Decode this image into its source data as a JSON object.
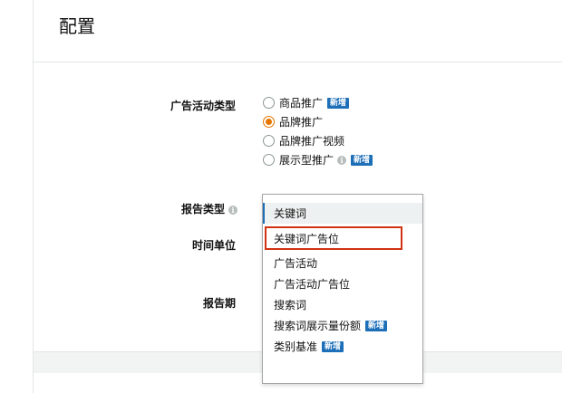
{
  "page": {
    "title": "配置"
  },
  "form": {
    "campaign_type_label": "广告活动类型",
    "campaign_types": [
      {
        "label": "商品推广",
        "badge": "新增",
        "checked": false
      },
      {
        "label": "品牌推广",
        "badge": "",
        "checked": true
      },
      {
        "label": "品牌推广视频",
        "badge": "",
        "checked": false
      },
      {
        "label": "展示型推广",
        "badge": "新增",
        "checked": false
      }
    ],
    "report_type_label": "报告类型",
    "time_unit_label": "时间单位",
    "report_period_label": "报告期"
  },
  "dropdown": {
    "options": [
      {
        "label": "关键词",
        "badge": ""
      },
      {
        "label": "关键词广告位",
        "badge": ""
      },
      {
        "label": "广告活动",
        "badge": ""
      },
      {
        "label": "广告活动广告位",
        "badge": ""
      },
      {
        "label": "搜索词",
        "badge": ""
      },
      {
        "label": "搜索词展示量份额",
        "badge": "新增"
      },
      {
        "label": "类别基准",
        "badge": "新增"
      }
    ],
    "selected_index": 0,
    "highlighted_index": 1
  },
  "colors": {
    "accent_radio": "#e77600",
    "badge_bg": "#1d6fb8",
    "highlight_border": "#d13212"
  },
  "icons": {
    "info": "info-icon"
  }
}
